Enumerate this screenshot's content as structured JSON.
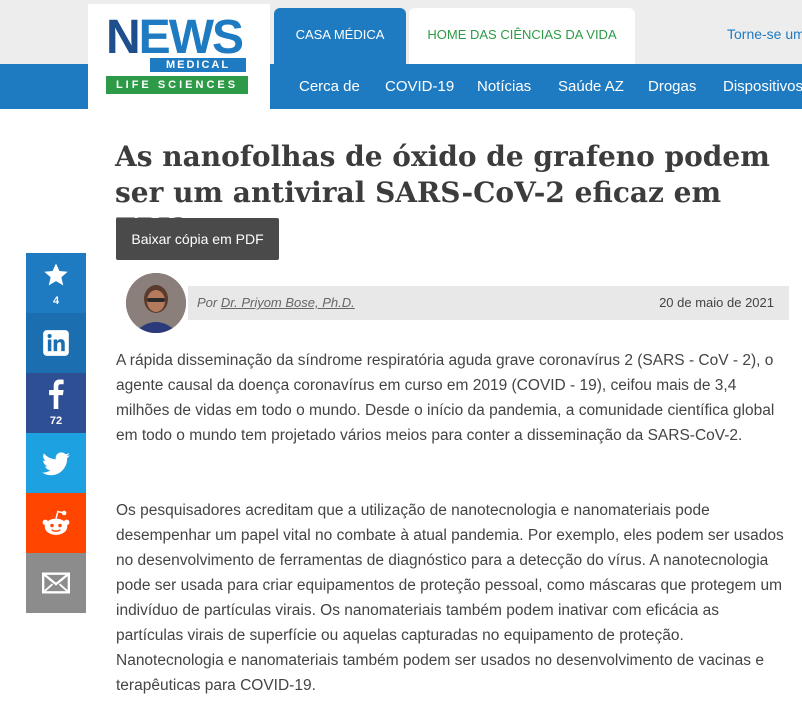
{
  "header": {
    "logo": {
      "word": "NEWS",
      "line2": "MEDICAL",
      "line3": "LIFE SCIENCES"
    },
    "tabs": [
      {
        "label": "CASA MÉDICA"
      },
      {
        "label": "HOME DAS CIÊNCIAS DA VIDA"
      }
    ],
    "account_link": "Torne-se um"
  },
  "nav": {
    "items": [
      {
        "label": "Cerca de"
      },
      {
        "label": "COVID-19"
      },
      {
        "label": "Notícias"
      },
      {
        "label": "Saúde AZ"
      },
      {
        "label": "Drogas"
      },
      {
        "label": "Dispositivos"
      }
    ]
  },
  "article": {
    "title": "As nanofolhas de óxido de grafeno podem ser um antiviral SARS-CoV-2 eficaz em EPI?",
    "pdf_button": "Baixar cópia em PDF",
    "byline_prefix": "Por",
    "author": "Dr. Priyom Bose, Ph.D.",
    "date": "20 de maio de 2021",
    "paragraphs": [
      "A rápida disseminação da síndrome respiratória aguda grave coronavírus 2 (SARS - CoV - 2), o agente causal da doença coronavírus em curso em 2019 (COVID - 19), ceifou mais de 3,4 milhões de vidas em todo o mundo. Desde o início da pandemia, a comunidade científica global em todo o mundo tem projetado vários meios para conter a disseminação da SARS-CoV-2.",
      "Os pesquisadores acreditam que a utilização de nanotecnologia e nanomateriais pode desempenhar um papel vital no combate à atual pandemia. Por exemplo, eles podem ser usados no desenvolvimento de ferramentas de diagnóstico para a detecção do vírus. A nanotecnologia pode ser usada para criar equipamentos de proteção pessoal, como máscaras que protegem um indivíduo de partículas virais. Os nanomateriais também podem inativar com eficácia as partículas virais de superfície ou aquelas capturadas no equipamento de proteção. Nanotecnologia e nanomateriais também podem ser usados no desenvolvimento de vacinas e terapêuticas para COVID-19."
    ]
  },
  "share": {
    "favorite": {
      "icon": "star-icon",
      "count": "4",
      "color": "#1f7bc1"
    },
    "linkedin": {
      "icon": "linkedin-icon",
      "color": "#1b6fb1"
    },
    "facebook": {
      "icon": "facebook-icon",
      "count": "72",
      "color": "#2f4f95"
    },
    "twitter": {
      "icon": "twitter-icon",
      "color": "#1da1e0"
    },
    "reddit": {
      "icon": "reddit-icon",
      "color": "#ff4500"
    },
    "email": {
      "icon": "email-icon",
      "color": "#8c8c8c"
    }
  },
  "colors": {
    "brand_blue": "#1f7bc1",
    "brand_green": "#2c9a46",
    "title_text": "#3c3c3c"
  }
}
